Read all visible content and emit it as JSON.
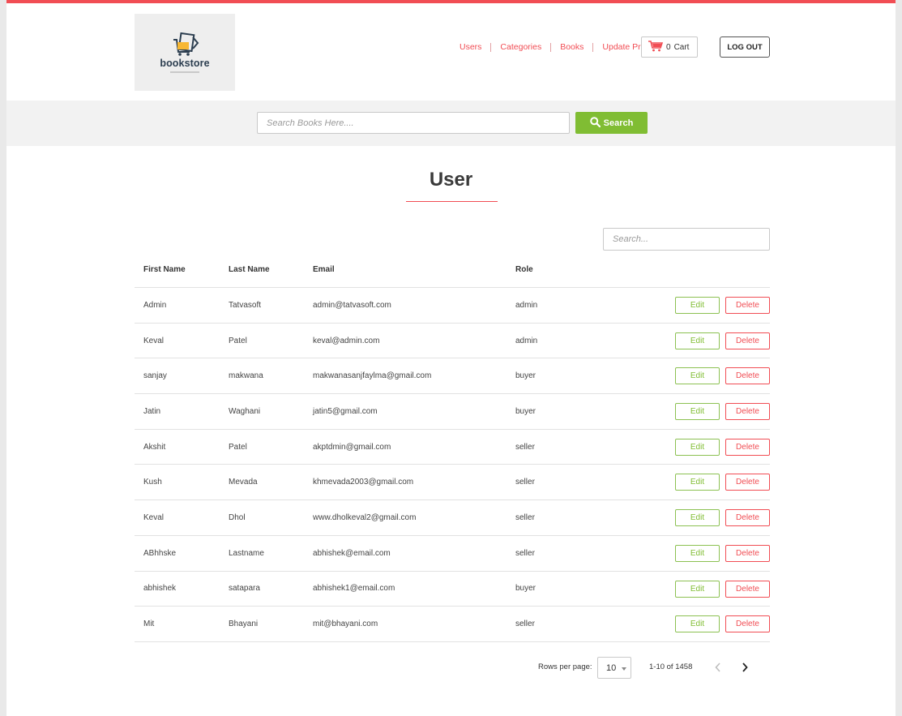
{
  "header": {
    "logo_text": "bookstore",
    "nav": [
      {
        "label": "Users"
      },
      {
        "label": "Categories"
      },
      {
        "label": "Books"
      },
      {
        "label": "Update Profile"
      }
    ],
    "cart": {
      "count": "0",
      "label": "Cart"
    },
    "logout_label": "LOG OUT"
  },
  "search": {
    "placeholder": "Search Books Here....",
    "button_label": "Search"
  },
  "main": {
    "title": "User",
    "table_search_placeholder": "Search...",
    "columns": [
      "First Name",
      "Last Name",
      "Email",
      "Role"
    ],
    "edit_label": "Edit",
    "delete_label": "Delete",
    "rows": [
      {
        "first": "Admin",
        "last": "Tatvasoft",
        "email": "admin@tatvasoft.com",
        "role": "admin"
      },
      {
        "first": "Keval",
        "last": "Patel",
        "email": "keval@admin.com",
        "role": "admin"
      },
      {
        "first": "sanjay",
        "last": "makwana",
        "email": "makwanasanjfaylma@gmail.com",
        "role": "buyer"
      },
      {
        "first": "Jatin",
        "last": "Waghani",
        "email": "jatin5@gmail.com",
        "role": "buyer"
      },
      {
        "first": "Akshit",
        "last": "Patel",
        "email": "akptdmin@gmail.com",
        "role": "seller"
      },
      {
        "first": "Kush",
        "last": "Mevada",
        "email": "khmevada2003@gmail.com",
        "role": "seller"
      },
      {
        "first": "Keval",
        "last": "Dhol",
        "email": "www.dholkeval2@gmail.com",
        "role": "seller"
      },
      {
        "first": "ABhhske",
        "last": "Lastname",
        "email": "abhishek@email.com",
        "role": "seller"
      },
      {
        "first": "abhishek",
        "last": "satapara",
        "email": "abhishek1@email.com",
        "role": "buyer"
      },
      {
        "first": "Mit",
        "last": "Bhayani",
        "email": "mit@bhayani.com",
        "role": "seller"
      }
    ]
  },
  "pagination": {
    "rows_per_page_label": "Rows per page:",
    "rows_per_page": "10",
    "range": "1-10 of 1458"
  },
  "colors": {
    "accent": "#f14d54",
    "success": "#80bd33"
  }
}
